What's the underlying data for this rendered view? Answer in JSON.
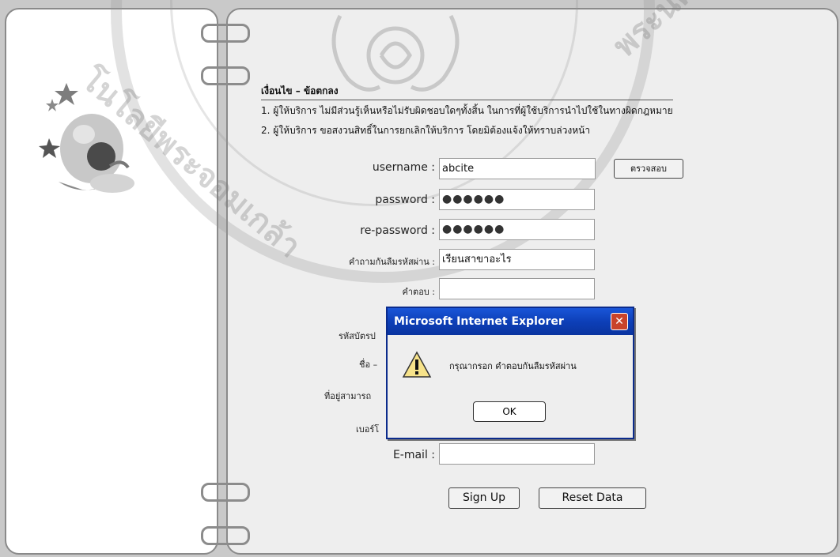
{
  "terms": {
    "title": "เงื่อนไข – ข้อตกลง",
    "line1": "1. ผู้ให้บริการ ไม่มีส่วนรู้เห็นหรือไม่รับผิดชอบใดๆทั้งสิ้น ในการที่ผู้ใช้บริการนำไปใช้ในทางผิดกฎหมาย",
    "line2": "2. ผู้ให้บริการ ขอสงวนสิทธิ์ในการยกเลิกให้บริการ โดยมิต้องแจ้งให้ทราบล่วงหน้า"
  },
  "form": {
    "username_label": "username :",
    "username_value": "abcite",
    "check_button": "ตรวจสอบ",
    "password_label": "password :",
    "password_value": "●●●●●●",
    "repassword_label": "re-password :",
    "repassword_value": "●●●●●●",
    "question_label": "คำถามกันลืมรหัสผ่าน :",
    "question_value": "เรียนสาขาอะไร",
    "answer_label": "คำตอบ :",
    "answer_value": "",
    "id_label_partial": "รหัสบัตรป",
    "name_label_partial": "ชื่อ –",
    "address_label_partial": "ที่อยู่สามารถ",
    "phone_label_partial": "เบอร์โ",
    "email_label": "E-mail :",
    "email_value": "",
    "signup_button": "Sign Up",
    "reset_button": "Reset Data"
  },
  "dialog": {
    "title": "Microsoft Internet Explorer",
    "close_glyph": "✕",
    "message": "กรุณากรอก คำตอบกันลืมรหัสผ่าน",
    "ok_button": "OK",
    "icon": "warning-icon"
  },
  "watermark": {
    "text_left": "โนโลยีพระจอมเกล้า",
    "text_right": "พระนครเหนือ"
  },
  "colors": {
    "titlebar": "#0d3fb8",
    "background": "#eeeeee"
  }
}
